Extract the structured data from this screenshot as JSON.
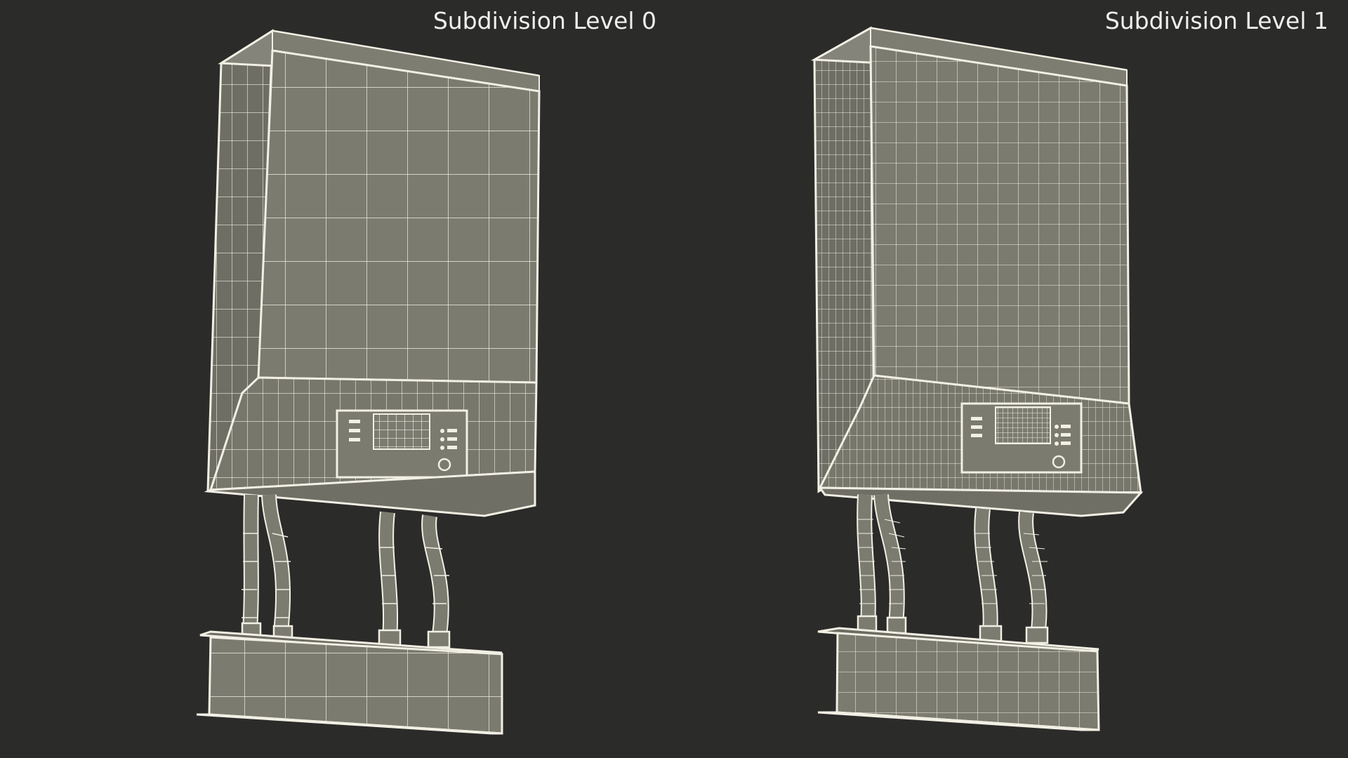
{
  "views": [
    {
      "id": "left",
      "caption": "Subdivision Level 0"
    },
    {
      "id": "right",
      "caption": "Subdivision Level 1"
    }
  ],
  "colors": {
    "background": "#2b2b2a",
    "surface": "#7b7b70",
    "wire": "#f2efe4",
    "text": "#f0f0ee"
  }
}
